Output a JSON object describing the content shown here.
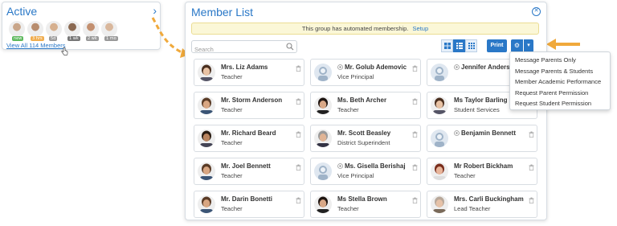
{
  "active_widget": {
    "title": "Active",
    "chevron": "›",
    "view_all": "View All 114 Members",
    "avatars": [
      {
        "color": "#c9a68a",
        "badge": "new",
        "badge_color": "#5cb85c"
      },
      {
        "color": "#b88d6e",
        "badge": "3 hrs",
        "badge_color": "#f0ad4e"
      },
      {
        "color": "#d6b08f",
        "badge": "5d",
        "badge_color": "#999999"
      },
      {
        "color": "#8b6a52",
        "badge": "1 wk",
        "badge_color": "#777777"
      },
      {
        "color": "#c39070",
        "badge": "2 wk",
        "badge_color": "#999999"
      },
      {
        "color": "#d9b79c",
        "badge": "1 mo",
        "badge_color": "#999999"
      }
    ]
  },
  "panel": {
    "title": "Member List",
    "close_icon": "⊗",
    "notice_text": "This group has automated membership.",
    "notice_link": "Setup",
    "search_placeholder": "Search",
    "print_label": "Print",
    "gear_icon": "⚙",
    "caret_icon": "▾"
  },
  "members": [
    {
      "name": "Mrs. Liz Adams",
      "role": "Teacher",
      "photo": "woman",
      "badge": false
    },
    {
      "name": "Mr. Golub Ademovic",
      "role": "Vice Principal",
      "photo": "placeholder",
      "badge": true
    },
    {
      "name": "Jennifer Anderson",
      "role": "",
      "photo": "placeholder",
      "badge": true
    },
    {
      "name": "Mr. Storm Anderson",
      "role": "Teacher",
      "photo": "man",
      "badge": false
    },
    {
      "name": "Ms. Beth Archer",
      "role": "Teacher",
      "photo": "woman-dark",
      "badge": false
    },
    {
      "name": "Ms Taylor Barling",
      "role": "Student Services",
      "photo": "woman",
      "badge": false
    },
    {
      "name": "Mr. Richard Beard",
      "role": "Teacher",
      "photo": "man-dark",
      "badge": false
    },
    {
      "name": "Mr. Scott Beasley",
      "role": "District Superindent",
      "photo": "man-grey",
      "badge": false
    },
    {
      "name": "Benjamin Bennett",
      "role": "",
      "photo": "placeholder",
      "badge": true
    },
    {
      "name": "Mr. Joel Bennett",
      "role": "Teacher",
      "photo": "man",
      "badge": false
    },
    {
      "name": "Ms. Gisella Berishaj",
      "role": "Vice Principal",
      "photo": "placeholder",
      "badge": true
    },
    {
      "name": "Mr Robert Bickham",
      "role": "Teacher",
      "photo": "man-red",
      "badge": false
    },
    {
      "name": "Mr. Darin Bonetti",
      "role": "Teacher",
      "photo": "man",
      "badge": false
    },
    {
      "name": "Ms Stella Brown",
      "role": "Teacher",
      "photo": "woman-dark",
      "badge": false
    },
    {
      "name": "Mrs. Carli Buckingham",
      "role": "Lead Teacher",
      "photo": "woman-grey",
      "badge": false
    }
  ],
  "menu": {
    "items": [
      "Message Parents Only",
      "Message Parents & Students",
      "Member Academic Performance",
      "Request Parent Permission",
      "Request Student Permission"
    ]
  },
  "colors": {
    "accent": "#2a78c7",
    "arrow": "#f0a93b",
    "notice_bg": "#fbf7d7"
  }
}
